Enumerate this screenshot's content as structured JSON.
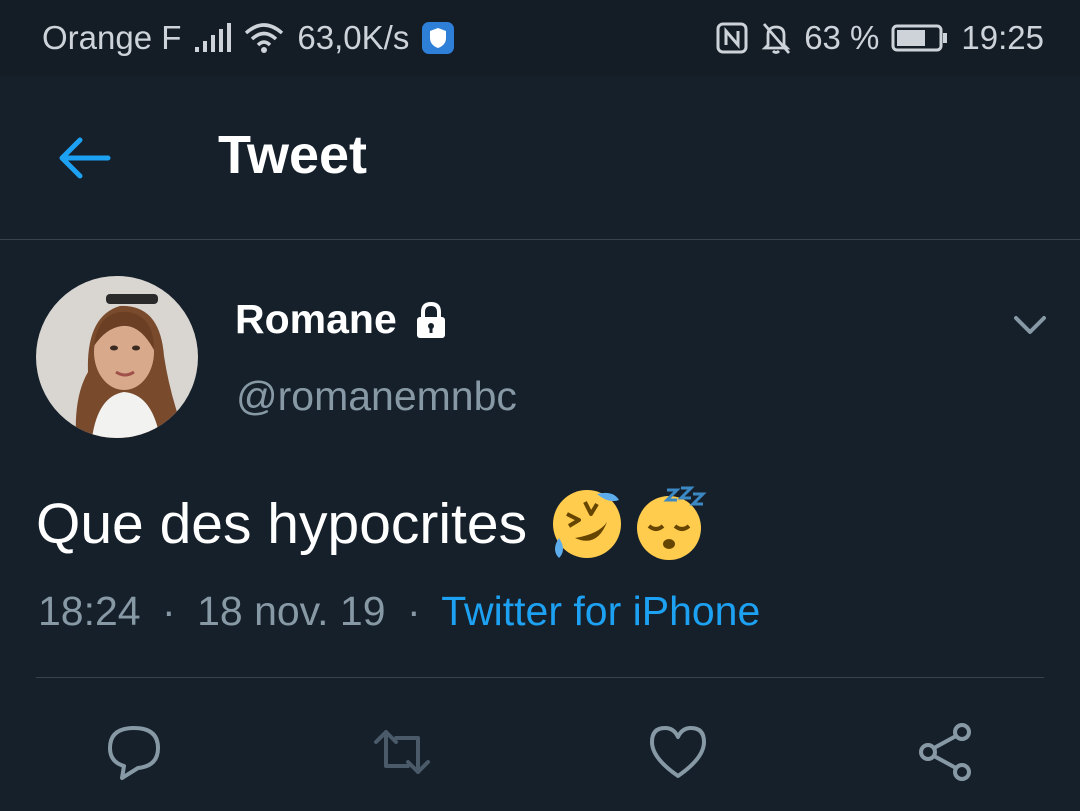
{
  "statusbar": {
    "carrier": "Orange F",
    "speed": "63,0K/s",
    "battery": "63 %",
    "time": "19:25"
  },
  "header": {
    "title": "Tweet"
  },
  "tweet": {
    "author_name": "Romane",
    "handle": "@romanemnbc",
    "text": "Que des hypocrites",
    "time": "18:24",
    "date": "18 nov. 19",
    "separator": "·",
    "source": "Twitter for iPhone",
    "emojis": [
      "rolling-on-floor-laughing-icon",
      "sleeping-face-icon"
    ]
  },
  "actions": [
    "reply-icon",
    "retweet-icon",
    "like-icon",
    "share-icon"
  ],
  "colors": {
    "background": "#15202b",
    "accent": "#1da1f2",
    "secondary_text": "#8899a6",
    "divider": "#38444d"
  }
}
